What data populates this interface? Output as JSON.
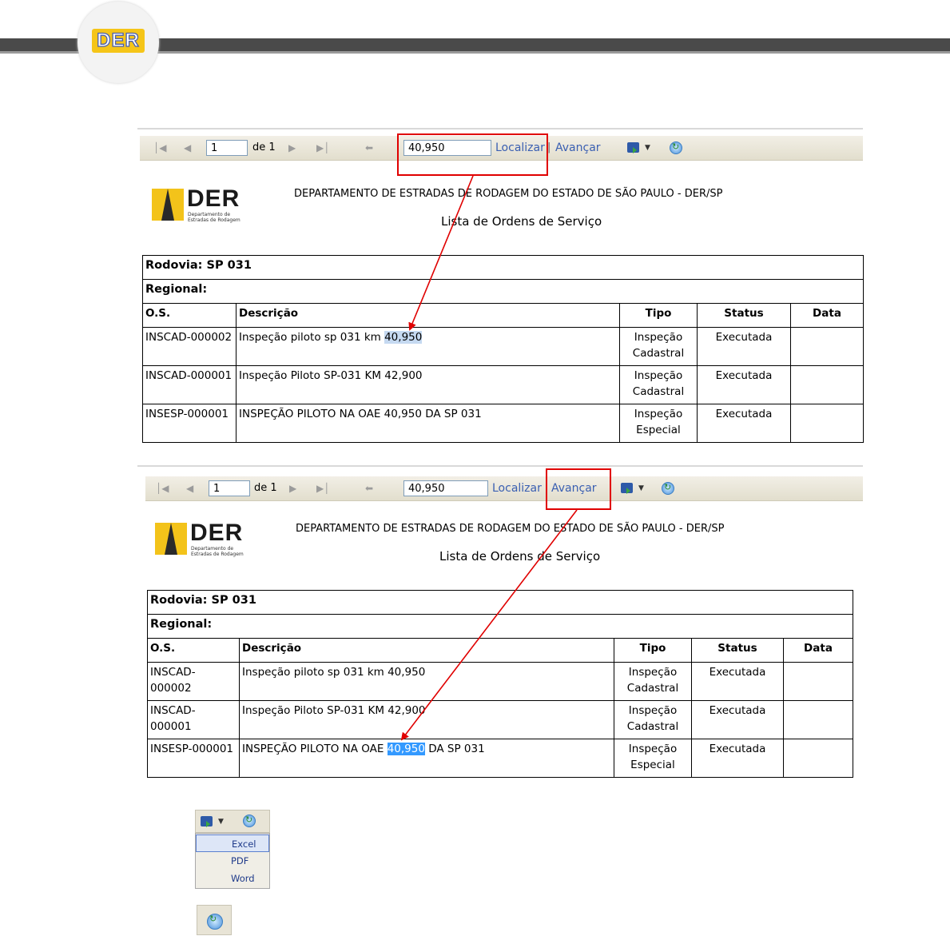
{
  "header": {
    "logo_text": "DER"
  },
  "reports": [
    {
      "toolbar": {
        "page_value": "1",
        "page_of": "de 1",
        "search_value": "40,950",
        "find_label": "Localizar",
        "separator": "|",
        "next_label": "Avançar"
      },
      "logo": {
        "name": "DER",
        "sub": "Departamento de Estradas de Rodagem"
      },
      "title": "DEPARTAMENTO DE ESTRADAS DE RODAGEM DO ESTADO DE SÃO PAULO - DER/SP",
      "subtitle": "Lista de Ordens de Serviço",
      "rodovia": "Rodovia: SP 031",
      "regional": "Regional:",
      "columns": [
        "O.S.",
        "Descrição",
        "Tipo",
        "Status",
        "Data"
      ],
      "rows": [
        {
          "os": "INSCAD-000002",
          "desc_pre": "Inspeção piloto sp 031 km ",
          "desc_hl": "40,950",
          "desc_post": "",
          "tipo1": "Inspeção",
          "tipo2": "Cadastral",
          "status": "Executada",
          "data": ""
        },
        {
          "os": "INSCAD-000001",
          "desc_pre": "Inspeção Piloto SP-031 KM 42,900",
          "desc_hl": "",
          "desc_post": "",
          "tipo1": "Inspeção",
          "tipo2": "Cadastral",
          "status": "Executada",
          "data": ""
        },
        {
          "os": "INSESP-000001",
          "desc_pre": "INSPEÇÃO PILOTO NA OAE 40,950 DA SP 031",
          "desc_hl": "",
          "desc_post": "",
          "tipo1": "Inspeção",
          "tipo2": "Especial",
          "status": "Executada",
          "data": ""
        }
      ]
    },
    {
      "toolbar": {
        "page_value": "1",
        "page_of": "de 1",
        "search_value": "40,950",
        "find_label": "Localizar",
        "separator": "",
        "next_label": "Avançar"
      },
      "logo": {
        "name": "DER",
        "sub": "Departamento de Estradas de Rodagem"
      },
      "title": "DEPARTAMENTO DE ESTRADAS DE RODAGEM DO ESTADO DE SÃO PAULO - DER/SP",
      "subtitle": "Lista de Ordens de Serviço",
      "rodovia": "Rodovia: SP 031",
      "regional": "Regional:",
      "columns": [
        "O.S.",
        "Descrição",
        "Tipo",
        "Status",
        "Data"
      ],
      "rows": [
        {
          "os": "INSCAD-000002",
          "desc_pre": "Inspeção piloto sp 031 km 40,950",
          "desc_hl": "",
          "desc_post": "",
          "tipo1": "Inspeção",
          "tipo2": "Cadastral",
          "status": "Executada",
          "data": ""
        },
        {
          "os": "INSCAD-000001",
          "desc_pre": "Inspeção Piloto SP-031 KM 42,900",
          "desc_hl": "",
          "desc_post": "",
          "tipo1": "Inspeção",
          "tipo2": "Cadastral",
          "status": "Executada",
          "data": ""
        },
        {
          "os": "INSESP-000001",
          "desc_pre": "INSPEÇÃO PILOTO NA OAE ",
          "desc_hl": "40,950",
          "desc_post": " DA SP 031",
          "tipo1": "Inspeção",
          "tipo2": "Especial",
          "status": "Executada",
          "data": ""
        }
      ]
    }
  ],
  "export_menu": {
    "items": [
      "Excel",
      "PDF",
      "Word"
    ],
    "selected": "Excel"
  },
  "colors": {
    "annotation": "#e00000",
    "link": "#3a5fb2",
    "highlight_light": "#c5d9f1",
    "highlight_strong": "#3399ff"
  },
  "icons": [
    "first-page-icon",
    "prev-page-icon",
    "next-page-icon",
    "last-page-icon",
    "back-icon",
    "save-export-icon",
    "refresh-icon"
  ]
}
